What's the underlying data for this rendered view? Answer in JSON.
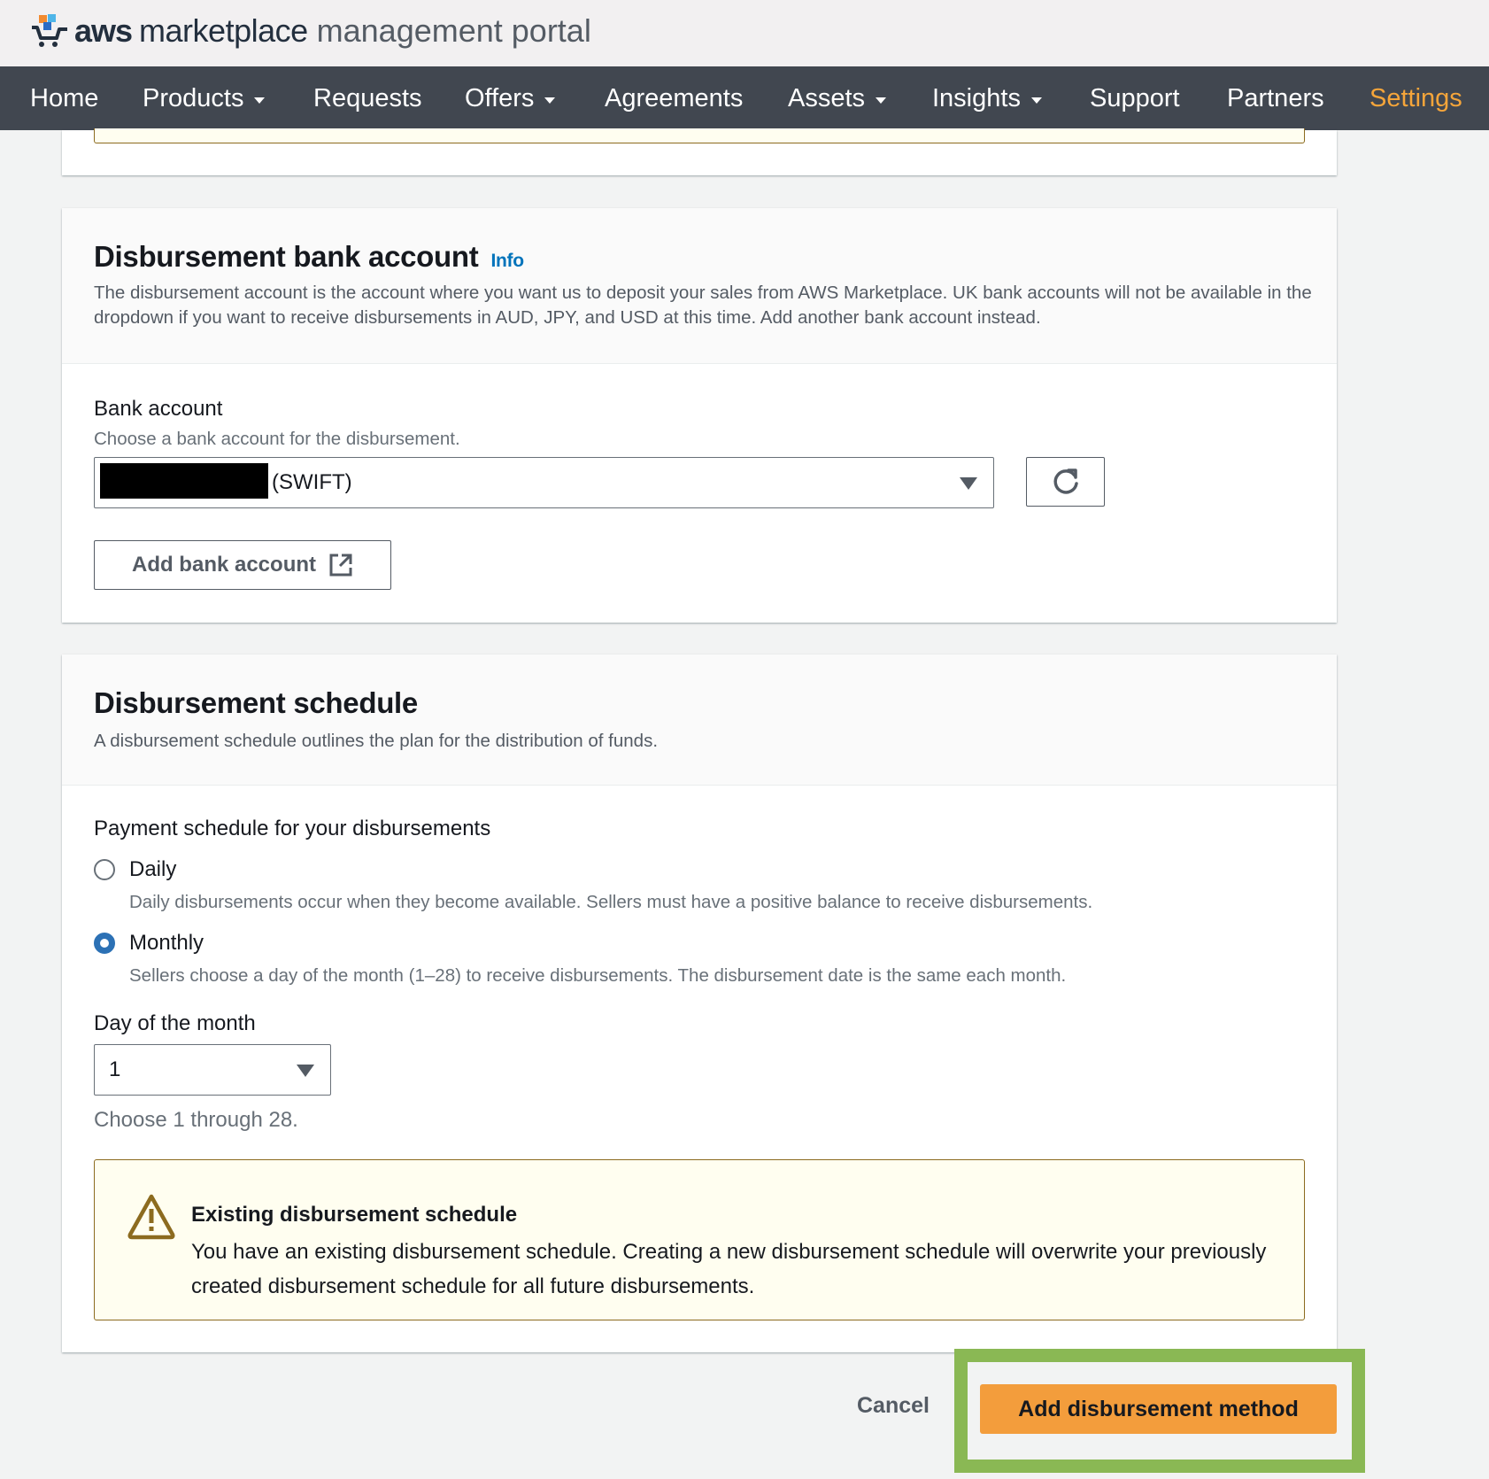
{
  "header": {
    "logo_aws": "aws",
    "logo_marketplace": "marketplace",
    "logo_portal": "management portal"
  },
  "nav": {
    "items": [
      {
        "label": "Home",
        "dropdown": false
      },
      {
        "label": "Products",
        "dropdown": true
      },
      {
        "label": "Requests",
        "dropdown": false
      },
      {
        "label": "Offers",
        "dropdown": true
      },
      {
        "label": "Agreements",
        "dropdown": false
      },
      {
        "label": "Assets",
        "dropdown": true
      },
      {
        "label": "Insights",
        "dropdown": true
      },
      {
        "label": "Support",
        "dropdown": false
      },
      {
        "label": "Partners",
        "dropdown": false
      },
      {
        "label": "Settings",
        "dropdown": false,
        "active": true
      }
    ],
    "active_color": "#f5a53a"
  },
  "bank_section": {
    "title": "Disbursement bank account",
    "info_label": "Info",
    "description": "The disbursement account is the account where you want us to deposit your sales from AWS Marketplace. UK bank accounts will not be available in the dropdown if you want to receive disbursements in AUD, JPY, and USD at this time. Add another bank account instead.",
    "field_label": "Bank account",
    "field_hint": "Choose a bank account for the disbursement.",
    "selected_value_suffix": "(SWIFT)",
    "selected_value_redacted": true,
    "refresh_icon": "refresh-icon",
    "add_button_label": "Add bank account",
    "add_button_icon": "external-link-icon"
  },
  "schedule_section": {
    "title": "Disbursement schedule",
    "description": "A disbursement schedule outlines the plan for the distribution of funds.",
    "payment_label": "Payment schedule for your disbursements",
    "options": [
      {
        "label": "Daily",
        "description": "Daily disbursements occur when they become available. Sellers must have a positive balance to receive disbursements.",
        "checked": false
      },
      {
        "label": "Monthly",
        "description": "Sellers choose a day of the month (1–28) to receive disbursements. The disbursement date is the same each month.",
        "checked": true
      }
    ],
    "day_label": "Day of the month",
    "day_value": "1",
    "day_hint": "Choose 1 through 28.",
    "alert": {
      "icon": "warning-icon",
      "title": "Existing disbursement schedule",
      "body": "You have an existing disbursement schedule. Creating a new disbursement schedule will overwrite your previously created disbursement schedule for all future disbursements."
    }
  },
  "footer": {
    "cancel_label": "Cancel",
    "primary_label": "Add disbursement method",
    "primary_color": "#f39d3c",
    "highlight_color": "#8ab854"
  }
}
